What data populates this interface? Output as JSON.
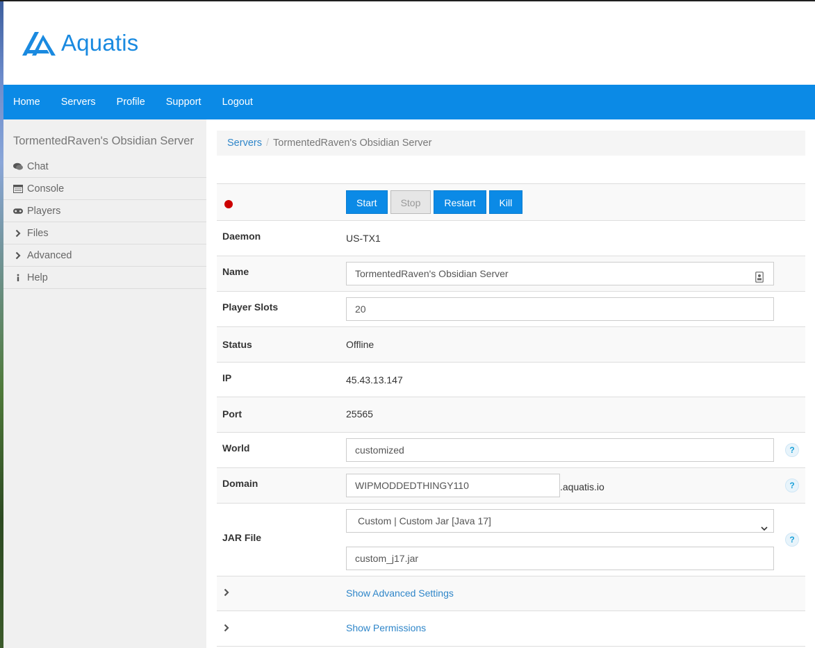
{
  "brand": {
    "name": "Aquatis",
    "color": "#1a8ae0"
  },
  "nav": [
    "Home",
    "Servers",
    "Profile",
    "Support",
    "Logout"
  ],
  "sidebar": {
    "title": "TormentedRaven's Obsidian Server",
    "items": [
      {
        "label": "Chat",
        "icon": "chat-icon"
      },
      {
        "label": "Console",
        "icon": "console-icon"
      },
      {
        "label": "Players",
        "icon": "gamepad-icon"
      },
      {
        "label": "Files",
        "icon": "chevron-right-icon"
      },
      {
        "label": "Advanced",
        "icon": "chevron-right-icon"
      },
      {
        "label": "Help",
        "icon": "info-icon"
      }
    ]
  },
  "breadcrumb": {
    "root": "Servers",
    "separator": "/",
    "current": "TormentedRaven's Obsidian Server"
  },
  "controls": {
    "start": "Start",
    "stop": "Stop",
    "restart": "Restart",
    "kill": "Kill",
    "status_color": "#cc0000"
  },
  "fields": {
    "daemon": {
      "label": "Daemon",
      "value": "US-TX1"
    },
    "name": {
      "label": "Name",
      "value": "TormentedRaven's Obsidian Server"
    },
    "player_slots": {
      "label": "Player Slots",
      "value": "20"
    },
    "status": {
      "label": "Status",
      "value": "Offline"
    },
    "ip": {
      "label": "IP",
      "value": "45.43.13.147"
    },
    "port": {
      "label": "Port",
      "value": "25565"
    },
    "world": {
      "label": "World",
      "value": "customized"
    },
    "domain": {
      "label": "Domain",
      "value": "WIPMODDEDTHINGY110",
      "suffix": ".aquatis.io"
    },
    "jar": {
      "label": "JAR File",
      "selected": "Custom | Custom Jar [Java 17]",
      "value": "custom_j17.jar"
    }
  },
  "links": {
    "advanced": "Show Advanced Settings",
    "permissions": "Show Permissions"
  },
  "help_glyph": "?"
}
